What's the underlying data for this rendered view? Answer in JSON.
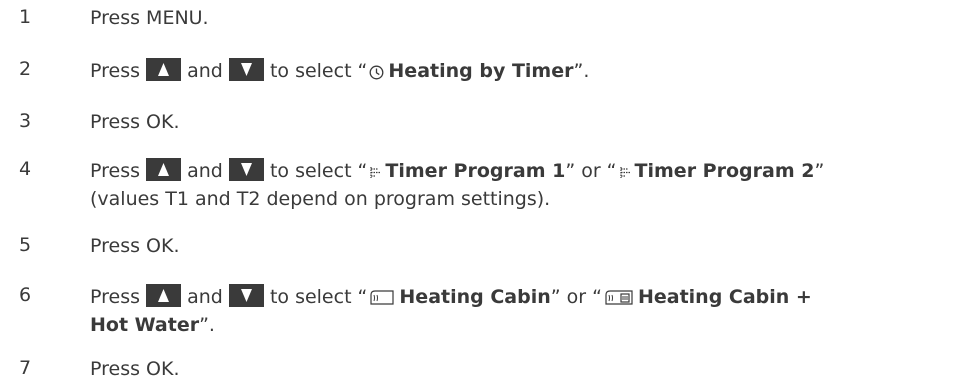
{
  "steps": [
    {
      "num": "1",
      "text": "Press MENU."
    },
    {
      "num": "2",
      "press": "Press",
      "and": "and",
      "select": "to select “",
      "bold": "Heating by Timer",
      "end": "”."
    },
    {
      "num": "3",
      "text": "Press OK."
    },
    {
      "num": "4",
      "press": "Press",
      "and": "and",
      "select": "to select “",
      "bold1": "Timer Program 1",
      "or": "” or “",
      "bold2": "Timer Program 2",
      "end": "”",
      "line2": "(values T1 and T2 depend on program settings)."
    },
    {
      "num": "5",
      "text": "Press OK."
    },
    {
      "num": "6",
      "press": "Press",
      "and": "and",
      "select": "to select “",
      "bold1": "Heating Cabin",
      "or": "” or “",
      "bold2": "Heating Cabin +",
      "bold2b": "Hot Water",
      "end": "”."
    },
    {
      "num": "7",
      "text": "Press OK."
    }
  ],
  "icons": {
    "up": "arrow-up-button",
    "down": "arrow-down-button",
    "clock": "clock-icon",
    "timer": "timer-program-icon",
    "cabin": "cabin-heating-icon",
    "cabin_water": "cabin-hot-water-icon"
  },
  "colors": {
    "text": "#3a3a3a",
    "button": "#3a3a3a",
    "arrow": "#ffffff"
  }
}
